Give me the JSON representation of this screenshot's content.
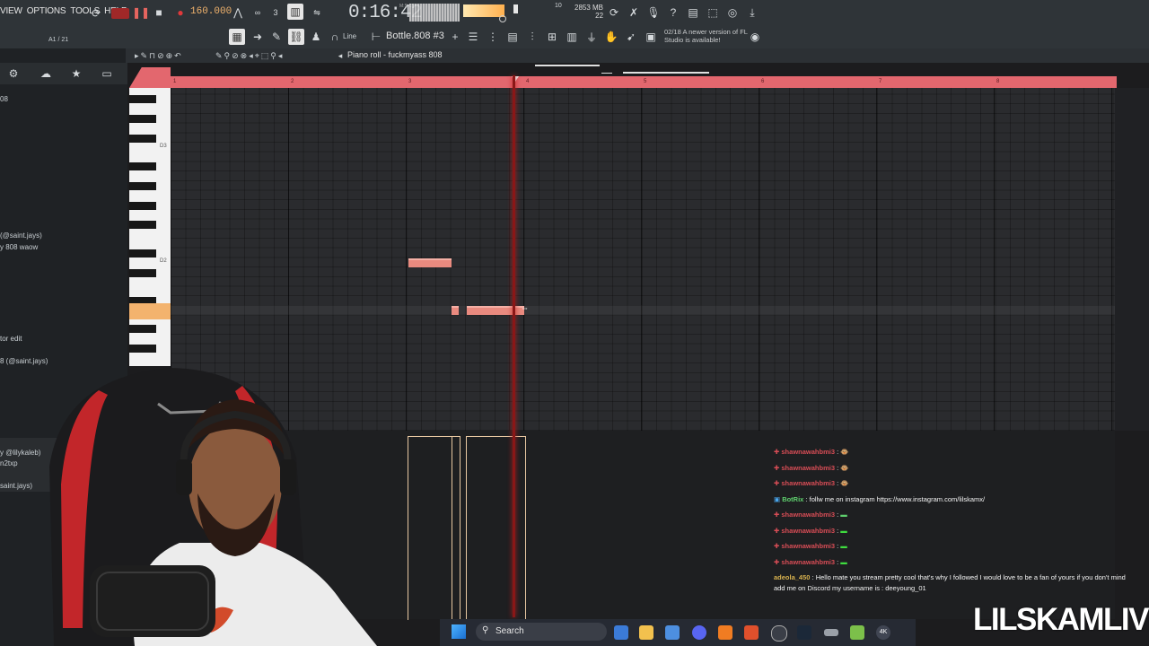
{
  "menu": [
    "VIEW",
    "OPTIONS",
    "TOOLS",
    "HELP"
  ],
  "transport": {
    "bpm": "160.000",
    "time": "0:16:42",
    "msc": "M:S:CS",
    "cpu": [
      "2853 MB",
      "22"
    ],
    "cpu_top": "10"
  },
  "pattern": "Bottle.808 #3",
  "snap": "Line",
  "news": "02/18  A newer version of FL Studio is available!",
  "browser": {
    "counter": "A1 / 21",
    "items": [
      "08",
      "(@saint.jays)",
      "y 808 waow",
      "tor edit",
      "8 (@saint.jays)",
      "y @lilykaleb)",
      "n2txp",
      "saint.jays)"
    ]
  },
  "piano_roll": {
    "title": "Piano roll - fuckmyass 808",
    "bars": [
      "1",
      "2",
      "3",
      "4",
      "5",
      "6",
      "7",
      "8"
    ],
    "keys": [
      "D3",
      "D2"
    ]
  },
  "chat": [
    {
      "user": "shawnawahbmi3",
      "text": ":"
    },
    {
      "user": "shawnawahbmi3",
      "text": ":"
    },
    {
      "user": "shawnawahbmi3",
      "text": ":"
    },
    {
      "user": "BotRix",
      "text": ": follw me on instagram https://www.instagram.com/lilskamx/"
    },
    {
      "user": "shawnawahbmi3",
      "text": ":"
    },
    {
      "user": "shawnawahbmi3",
      "text": ":"
    },
    {
      "user": "shawnawahbmi3",
      "text": ":"
    },
    {
      "user": "shawnawahbmi3",
      "text": ":"
    },
    {
      "user": "adeola_450",
      "text": ": Hello mate you stream pretty cool that's why I followed I would love to be a fan of yours if you don't mind add me on Discord my username is : deeyoung_01"
    }
  ],
  "watermark": "LILSKAMLIVE",
  "taskbar": {
    "search": "Search"
  }
}
